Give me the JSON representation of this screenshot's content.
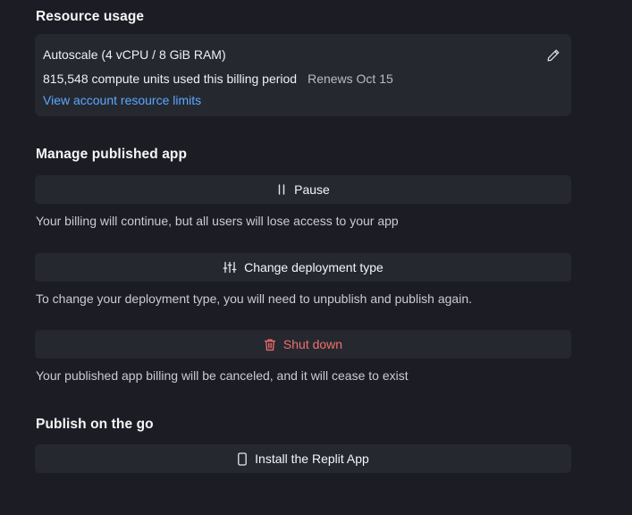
{
  "resource_usage": {
    "title": "Resource usage",
    "plan": "Autoscale (4 vCPU / 8 GiB RAM)",
    "usage": "815,548 compute units used this billing period",
    "renews": "Renews Oct 15",
    "limits_link": "View account resource limits",
    "edit_icon": "pencil-icon"
  },
  "manage": {
    "title": "Manage published app",
    "pause": {
      "label": "Pause",
      "icon": "pause-icon",
      "description": "Your billing will continue, but all users will lose access to your app"
    },
    "change_type": {
      "label": "Change deployment type",
      "icon": "sliders-icon",
      "description": "To change your deployment type, you will need to unpublish and publish again."
    },
    "shut_down": {
      "label": "Shut down",
      "icon": "trash-icon",
      "description": "Your published app billing will be canceled, and it will cease to exist"
    }
  },
  "publish_on_go": {
    "title": "Publish on the go",
    "install": {
      "label": "Install the Replit App",
      "icon": "phone-icon"
    }
  },
  "colors": {
    "background": "#1c1d24",
    "card": "#262830",
    "link": "#58a9ff",
    "danger": "#f2706b"
  }
}
